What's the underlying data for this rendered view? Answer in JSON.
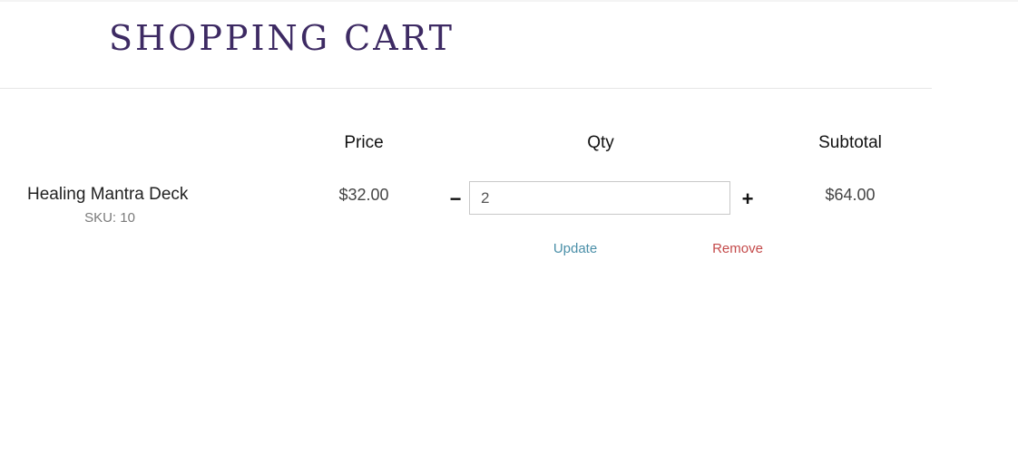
{
  "header": {
    "title": "SHOPPING CART"
  },
  "columns": {
    "price": "Price",
    "qty": "Qty",
    "subtotal": "Subtotal"
  },
  "item": {
    "name": "Healing Mantra Deck",
    "sku": "SKU: 10",
    "price": "$32.00",
    "quantity": "2",
    "decrement_label": "−",
    "increment_label": "+",
    "subtotal": "$64.00",
    "update_label": "Update",
    "remove_label": "Remove"
  },
  "colors": {
    "title": "#3d2a63",
    "update_link": "#4a8fa8",
    "remove_link": "#c44a4a"
  }
}
